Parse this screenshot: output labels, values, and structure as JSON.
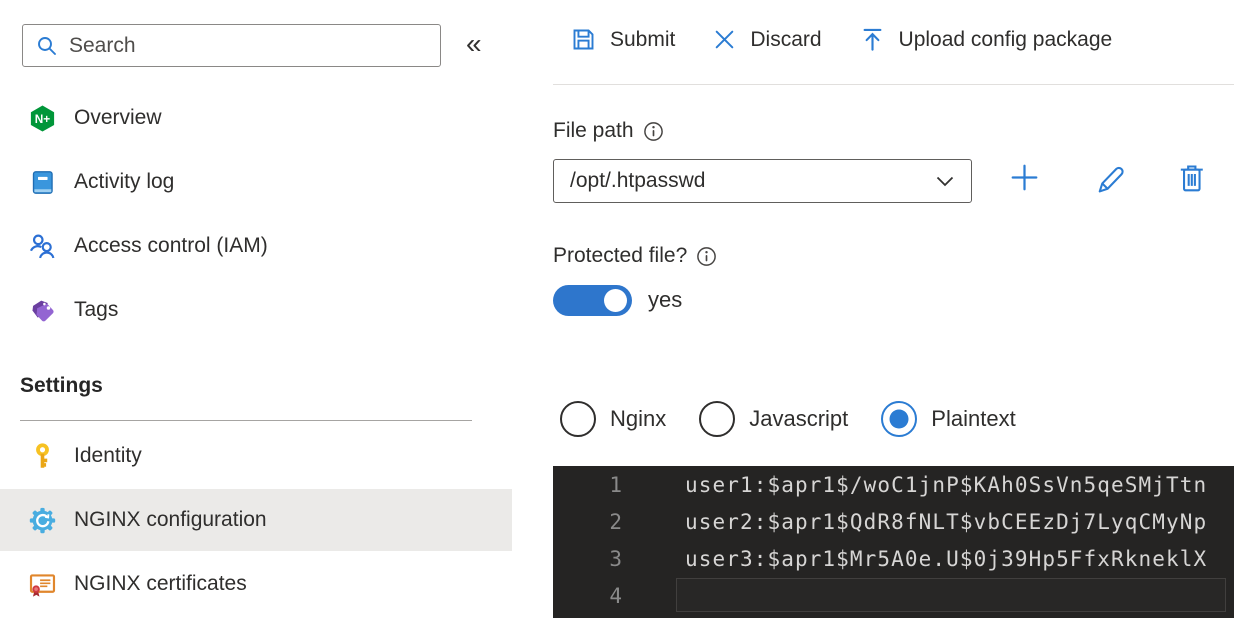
{
  "sidebar": {
    "search_placeholder": "Search",
    "collapse_glyph": "«",
    "items": [
      {
        "label": "Overview",
        "icon": "nginx-logo-icon",
        "selected": false
      },
      {
        "label": "Activity log",
        "icon": "book-icon",
        "selected": false
      },
      {
        "label": "Access control (IAM)",
        "icon": "people-icon",
        "selected": false
      },
      {
        "label": "Tags",
        "icon": "tag-icon",
        "selected": false
      }
    ],
    "settings_header": "Settings",
    "settings_items": [
      {
        "label": "Identity",
        "icon": "key-icon",
        "selected": false
      },
      {
        "label": "NGINX configuration",
        "icon": "gear-icon",
        "selected": true
      },
      {
        "label": "NGINX certificates",
        "icon": "certificate-icon",
        "selected": false
      }
    ]
  },
  "toolbar": {
    "items": [
      {
        "label": "Submit",
        "icon": "save-icon"
      },
      {
        "label": "Discard",
        "icon": "dismiss-icon"
      },
      {
        "label": "Upload config package",
        "icon": "upload-icon"
      }
    ]
  },
  "file_path": {
    "label": "File path",
    "value": "/opt/.htpasswd",
    "actions": [
      "add-icon",
      "edit-icon",
      "delete-icon"
    ]
  },
  "protected_file": {
    "label": "Protected file?",
    "state_label": "yes",
    "on": true
  },
  "syntax_options": [
    {
      "label": "Nginx",
      "selected": false
    },
    {
      "label": "Javascript",
      "selected": false
    },
    {
      "label": "Plaintext",
      "selected": true
    }
  ],
  "editor": {
    "lines": [
      {
        "number": "1",
        "text": "user1:$apr1$/woC1jnP$KAh0SsVn5qeSMjTtn"
      },
      {
        "number": "2",
        "text": "user2:$apr1$QdR8fNLT$vbCEEzDj7LyqCMyNp"
      },
      {
        "number": "3",
        "text": "user3:$apr1$Mr5A0e.U$0j39Hp5FfxRkneklX"
      },
      {
        "number": "4",
        "text": ""
      }
    ],
    "current_line": 4
  },
  "colors": {
    "accent_blue": "#2b7cd3",
    "toggle_on_blue": "#2e76cc",
    "nginx_green": "#009639",
    "selected_item_bg": "#ebeae8",
    "editor_background": "#252423",
    "editor_text": "#d6d5d4",
    "editor_line_number": "#8a8a8a"
  }
}
